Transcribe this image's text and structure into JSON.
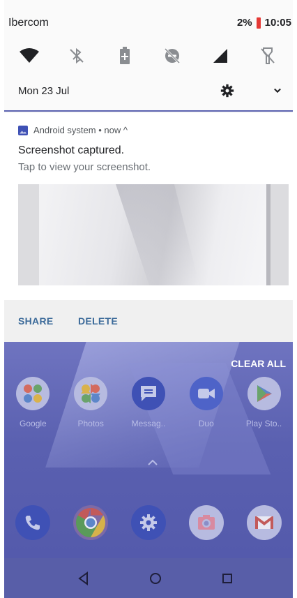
{
  "status_bar": {
    "carrier": "Ibercom",
    "battery": "2%",
    "time": "10:05"
  },
  "quick_settings": {
    "tiles": [
      {
        "name": "wifi-icon"
      },
      {
        "name": "bluetooth-off-icon"
      },
      {
        "name": "battery-saver-icon"
      },
      {
        "name": "do-not-disturb-off-icon"
      },
      {
        "name": "mobile-signal-icon"
      },
      {
        "name": "flashlight-off-icon"
      }
    ]
  },
  "date": "Mon 23 Jul",
  "notification": {
    "app": "Android system • now ^",
    "title": "Screenshot captured.",
    "text": "Tap to view your screenshot.",
    "actions": {
      "share": "SHARE",
      "delete": "DELETE"
    }
  },
  "clear_all": "CLEAR ALL",
  "apps": [
    {
      "label": "Google"
    },
    {
      "label": "Photos"
    },
    {
      "label": "Messag.."
    },
    {
      "label": "Duo"
    },
    {
      "label": "Play Sto.."
    }
  ],
  "dock": [
    {
      "name": "phone-icon"
    },
    {
      "name": "chrome-icon"
    },
    {
      "name": "settings-icon"
    },
    {
      "name": "camera-icon"
    },
    {
      "name": "gmail-icon"
    }
  ],
  "colors": {
    "accent": "#3d6b9a",
    "home_bg": "#5d64b2",
    "battery_low": "#e53935"
  }
}
